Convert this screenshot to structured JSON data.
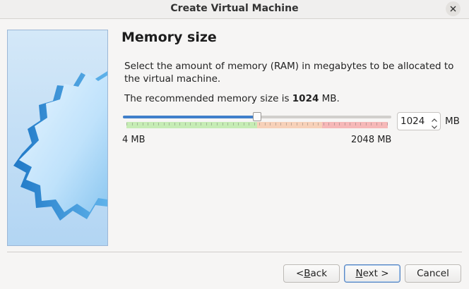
{
  "window": {
    "title": "Create Virtual Machine",
    "close_icon": "close-icon"
  },
  "page": {
    "heading": "Memory size",
    "description": "Select the amount of memory (RAM) in megabytes to be allocated to the virtual machine.",
    "recommend_prefix": "The recommended memory size is ",
    "recommend_value": "1024",
    "recommend_suffix": " MB."
  },
  "memory": {
    "value": "1024",
    "unit": "MB",
    "min_label": "4 MB",
    "max_label": "2048 MB",
    "min_mb": 4,
    "max_mb": 2048,
    "current_mb": 1024,
    "zones": [
      {
        "name": "green",
        "from_mb": 4,
        "to_mb": 1024
      },
      {
        "name": "orange",
        "from_mb": 1024,
        "to_mb": 1536
      },
      {
        "name": "red",
        "from_mb": 1536,
        "to_mb": 2048
      }
    ]
  },
  "buttons": {
    "back_mnemonic": "B",
    "back_rest": "ack",
    "back_prefix": "< ",
    "next_mnemonic": "N",
    "next_rest": "ext >",
    "cancel": "Cancel"
  },
  "colors": {
    "accent": "#3f7fca",
    "zone_green": "#c6ecb5",
    "zone_orange": "#f7d1b9",
    "zone_red": "#f6b8b8"
  }
}
